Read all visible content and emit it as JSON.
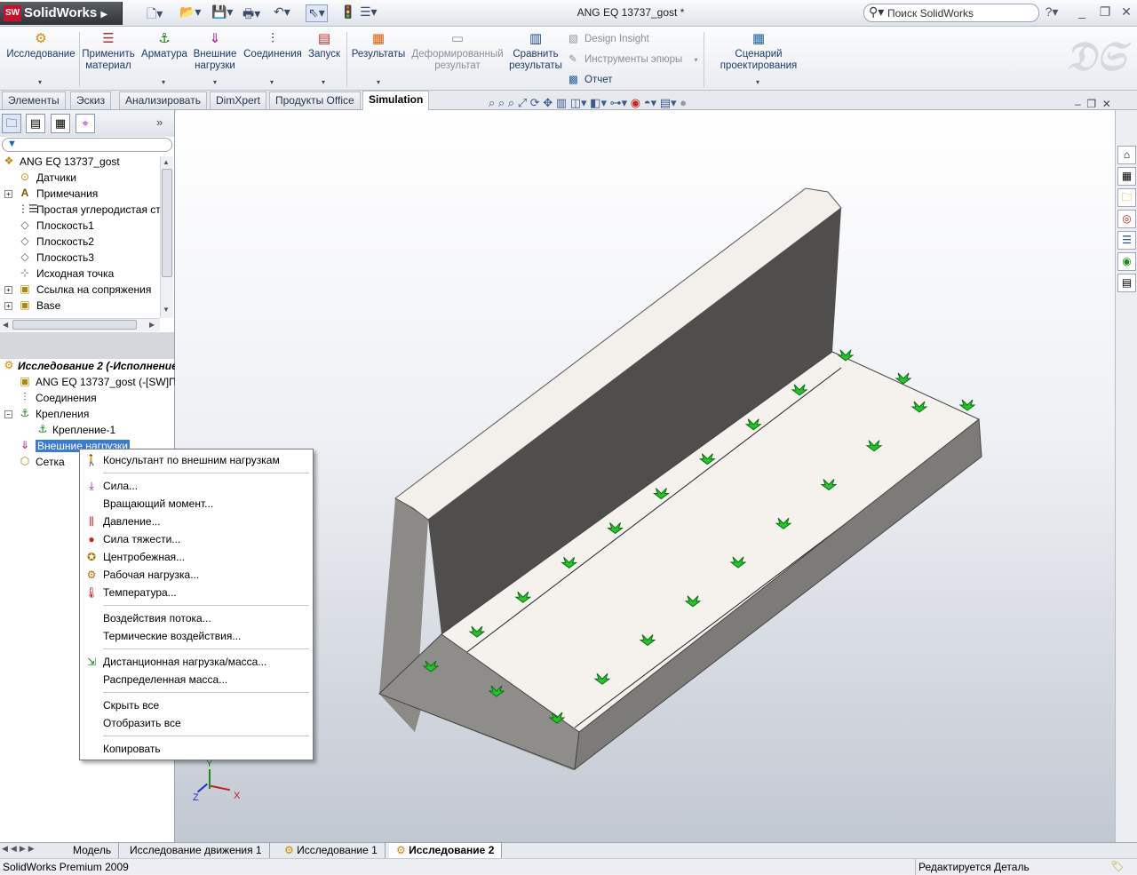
{
  "app": {
    "logo": "SolidWorks",
    "doc_title": "ANG EQ 13737_gost *",
    "search_placeholder": "Поиск SolidWorks",
    "help": "?"
  },
  "ribbon": {
    "items": [
      {
        "label": "Исследование",
        "icon": "study-icon"
      },
      {
        "label": "Применить\nматериал",
        "icon": "material-icon"
      },
      {
        "label": "Арматура",
        "icon": "fixture-icon"
      },
      {
        "label": "Внешние\nнагрузки",
        "icon": "loads-icon"
      },
      {
        "label": "Соединения",
        "icon": "connections-icon"
      },
      {
        "label": "Запуск",
        "icon": "run-icon"
      },
      {
        "label": "Результаты",
        "icon": "results-icon"
      },
      {
        "label": "Деформированный\nрезультат",
        "icon": "deformed-icon"
      },
      {
        "label": "Сравнить\nрезультаты",
        "icon": "compare-icon"
      },
      {
        "label": "Сценарий\nпроектирования",
        "icon": "design-scenario-icon"
      }
    ],
    "small": [
      "Design Insight",
      "Инструменты эпюры",
      "Отчет"
    ]
  },
  "tabs": [
    "Элементы",
    "Эскиз",
    "Анализировать",
    "DimXpert",
    "Продукты Office",
    "Simulation"
  ],
  "active_tab": "Simulation",
  "filter_icon": "filter-icon",
  "feature_tree": [
    {
      "label": "ANG EQ 13737_gost",
      "icon": "part-icon"
    },
    {
      "label": "Датчики",
      "icon": "sensor-icon"
    },
    {
      "label": "Примечания",
      "icon": "annotation-icon"
    },
    {
      "label": "Простая углеродистая ст",
      "icon": "material-icon"
    },
    {
      "label": "Плоскость1",
      "icon": "plane-icon"
    },
    {
      "label": "Плоскость2",
      "icon": "plane-icon"
    },
    {
      "label": "Плоскость3",
      "icon": "plane-icon"
    },
    {
      "label": "Исходная точка",
      "icon": "origin-icon"
    },
    {
      "label": "Ссылка на сопряжения",
      "icon": "mate-icon"
    },
    {
      "label": "Base",
      "icon": "base-icon"
    }
  ],
  "study_tree": [
    {
      "label": "Исследование 2 (-Исполнение",
      "icon": "study-icon"
    },
    {
      "label": "ANG EQ 13737_gost (-[SW]Пр",
      "icon": "part-icon"
    },
    {
      "label": "Соединения",
      "icon": "connections-icon"
    },
    {
      "label": "Крепления",
      "icon": "fixture-icon"
    },
    {
      "label": "Крепление-1",
      "icon": "fixture-icon"
    },
    {
      "label": "Внешние нагрузки",
      "icon": "loads-icon"
    },
    {
      "label": "Сетка",
      "icon": "mesh-icon"
    }
  ],
  "context_menu": [
    {
      "label": "Консультант по внешним нагрузкам",
      "icon": "advisor-icon"
    },
    {
      "label": "Сила...",
      "icon": "force-icon"
    },
    {
      "label": "Вращающий момент...",
      "icon": ""
    },
    {
      "label": "Давление...",
      "icon": "pressure-icon"
    },
    {
      "label": "Сила тяжести...",
      "icon": "gravity-icon"
    },
    {
      "label": "Центробежная...",
      "icon": "centrifugal-icon"
    },
    {
      "label": "Рабочая нагрузка...",
      "icon": "bearing-load-icon"
    },
    {
      "label": "Температура...",
      "icon": "temperature-icon"
    },
    {
      "label": "Воздействия потока...",
      "icon": ""
    },
    {
      "label": "Термические воздействия...",
      "icon": ""
    },
    {
      "label": "Дистанционная нагрузка/масса...",
      "icon": "remote-load-icon"
    },
    {
      "label": "Распределенная масса...",
      "icon": ""
    },
    {
      "label": "Скрыть все",
      "icon": ""
    },
    {
      "label": "Отобразить все",
      "icon": ""
    },
    {
      "label": "Копировать",
      "icon": ""
    }
  ],
  "bottom_tabs": [
    "Модель",
    "Исследование движения 1",
    "Исследование 1",
    "Исследование 2"
  ],
  "active_bottom_tab": "Исследование 2",
  "status": {
    "left": "SolidWorks Premium 2009",
    "right": "Редактируется Деталь"
  },
  "colors": {
    "accent": "#3a7bd5",
    "fixture": "#22c62a",
    "part_face": "#f5f2ee",
    "part_side": "#8c8a86"
  }
}
